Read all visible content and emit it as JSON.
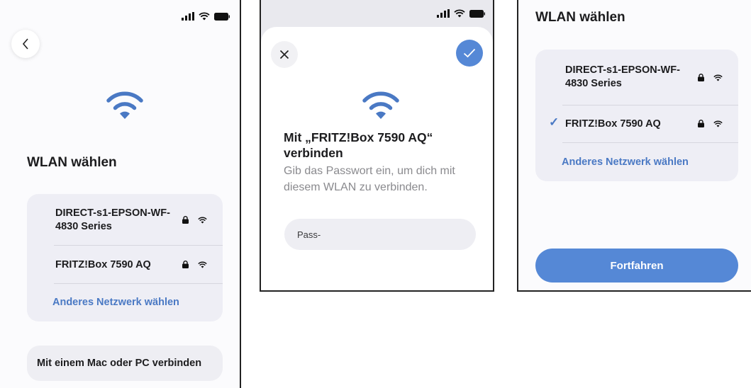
{
  "screen1": {
    "title": "WLAN wählen",
    "networks": [
      {
        "name": "DIRECT-s1-EPSON-WF-4830 Series",
        "locked": true
      },
      {
        "name": "FRITZ!Box 7590 AQ",
        "locked": true
      }
    ],
    "other_network": "Anderes Netzwerk wählen",
    "connect_mac_pc": "Mit einem Mac oder PC verbinden"
  },
  "screen2": {
    "title": "Mit „FRITZ!Box 7590 AQ“ verbinden",
    "subtitle": "Gib das Passwort ein, um dich mit diesem WLAN zu verbinden.",
    "password_value": "Pass-"
  },
  "screen3": {
    "title": "WLAN wählen",
    "networks": [
      {
        "name": "DIRECT-s1-EPSON-WF-4830 Series",
        "locked": true,
        "selected": false
      },
      {
        "name": "FRITZ!Box 7590 AQ",
        "locked": true,
        "selected": true
      }
    ],
    "selected_mark": "✓",
    "other_network": "Anderes Netzwerk wählen",
    "continue_label": "Fortfahren"
  },
  "colors": {
    "accent": "#5588d6",
    "link": "#4a79c4",
    "card": "#eeeef5"
  }
}
